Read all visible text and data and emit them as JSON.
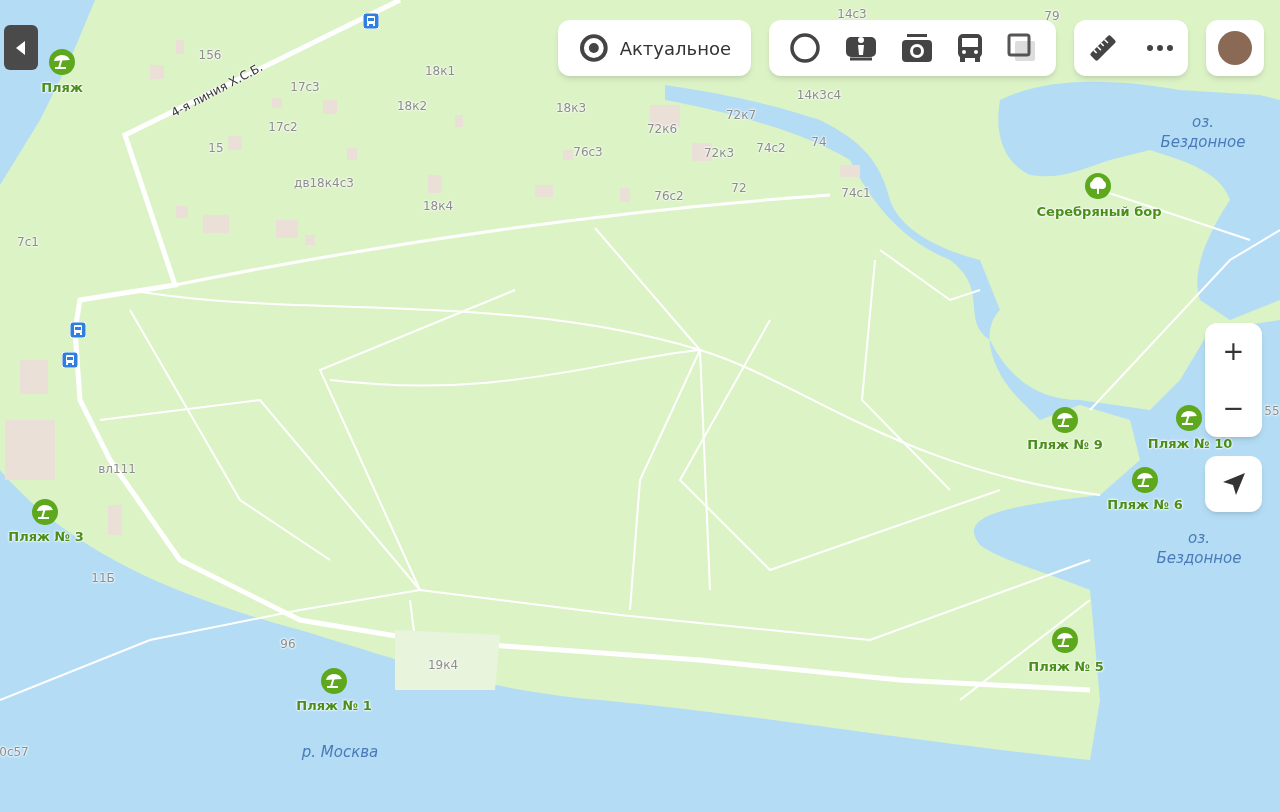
{
  "top_bar": {
    "current_button": {
      "label": "Актуальное"
    }
  },
  "zoom": {
    "in": "+",
    "out": "−"
  },
  "map": {
    "places": [
      {
        "kind": "beach",
        "label": "Пляж"
      },
      {
        "kind": "park",
        "label": "Серебряный бор"
      },
      {
        "kind": "beach",
        "label": "Пляж № 9"
      },
      {
        "kind": "beach",
        "label": "Пляж № 10"
      },
      {
        "kind": "beach",
        "label": "Пляж № 6"
      },
      {
        "kind": "beach",
        "label": "Пляж № 3"
      },
      {
        "kind": "beach",
        "label": "Пляж № 5"
      },
      {
        "kind": "beach",
        "label": "Пляж № 1"
      }
    ],
    "water_labels": [
      {
        "lines": [
          "оз.",
          "Бездонное"
        ]
      },
      {
        "lines": [
          "оз.",
          "Бездонное"
        ]
      },
      {
        "lines": [
          "р. Москва"
        ]
      }
    ],
    "street_labels": [
      "4-я линия Х.С.Б."
    ],
    "building_numbers": [
      "14с3",
      "79",
      "156",
      "18к1",
      "17с3",
      "18к2",
      "18к3",
      "14к3с4",
      "72к7",
      "17с2",
      "72к6",
      "74",
      "15",
      "74с2",
      "76с3",
      "72к3",
      "дв18к4с3",
      "76с2",
      "72",
      "74с1",
      "18к4",
      "7с1",
      "55",
      "вл111",
      "11Б",
      "96",
      "19к4",
      "0с57"
    ]
  }
}
